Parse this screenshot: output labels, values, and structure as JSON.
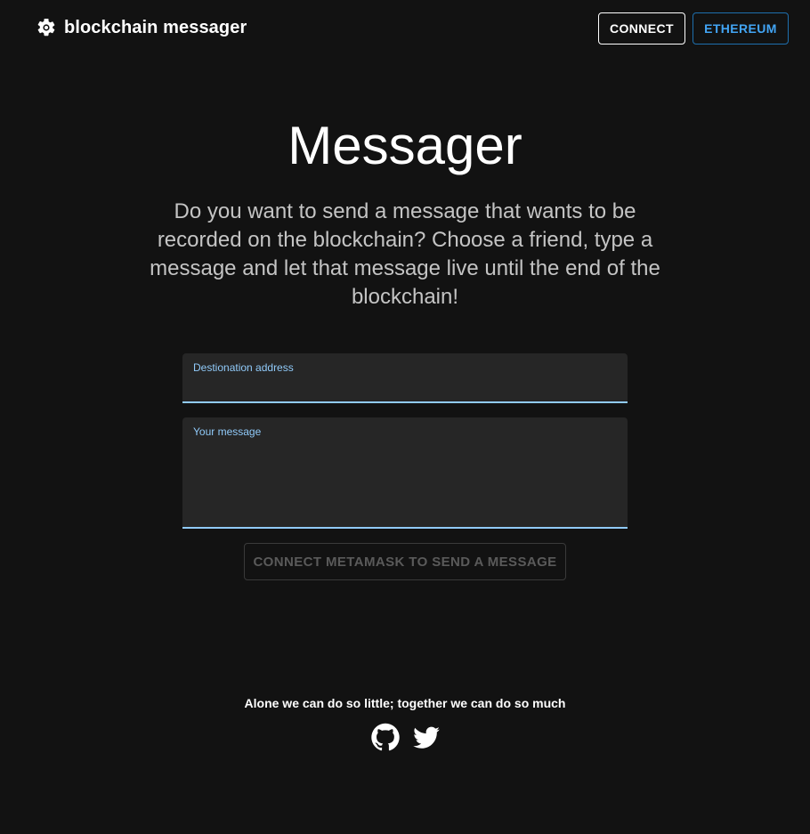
{
  "header": {
    "brand_title": "blockchain messager",
    "brand_icon": "gear-icon",
    "connect_label": "CONNECT",
    "network_label": "ETHEREUM"
  },
  "main": {
    "title": "Messager",
    "description": "Do you want to send a message that wants to be recorded on the blockchain? Choose a friend, type a message and let that message live until the end of the blockchain!",
    "address_field": {
      "label": "Destionation address",
      "value": ""
    },
    "message_field": {
      "label": "Your message",
      "value": ""
    },
    "send_button_label": "CONNECT METAMASK TO SEND A MESSAGE"
  },
  "footer": {
    "quote": "Alone we can do so little; together we can do so much",
    "social": [
      "github-icon",
      "twitter-icon"
    ]
  },
  "colors": {
    "background": "#121212",
    "accent": "#90caf9",
    "network_accent": "#42a5f5",
    "field_bg": "#262626"
  }
}
